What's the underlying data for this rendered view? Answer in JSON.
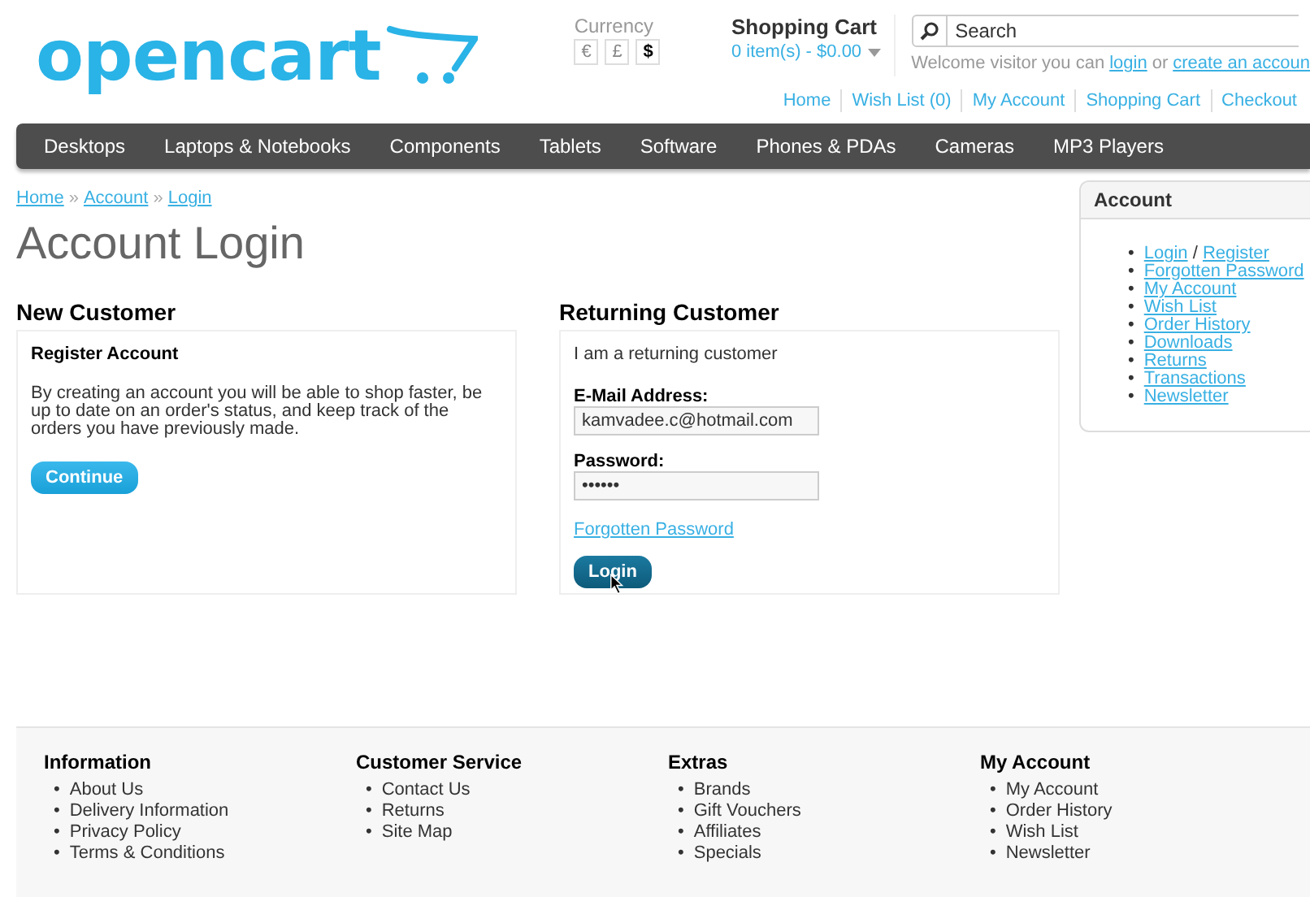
{
  "logo": {
    "text": "opencart"
  },
  "currency": {
    "label": "Currency",
    "options": [
      {
        "symbol": "€",
        "selected": false
      },
      {
        "symbol": "£",
        "selected": false
      },
      {
        "symbol": "$",
        "selected": true
      }
    ]
  },
  "cart": {
    "title": "Shopping Cart",
    "summary": "0 item(s) - $0.00"
  },
  "search": {
    "placeholder": "Search"
  },
  "welcome": {
    "text": "Welcome visitor you can",
    "login": "login",
    "or": "or",
    "create": "create an accoun"
  },
  "top_links": [
    "Home",
    "Wish List (0)",
    "My Account",
    "Shopping Cart",
    "Checkout"
  ],
  "menu": [
    "Desktops",
    "Laptops & Notebooks",
    "Components",
    "Tablets",
    "Software",
    "Phones & PDAs",
    "Cameras",
    "MP3 Players"
  ],
  "breadcrumb": {
    "items": [
      "Home",
      "Account",
      "Login"
    ],
    "separator": "»"
  },
  "page_title": "Account Login",
  "new_customer": {
    "heading": "New Customer",
    "subheading": "Register Account",
    "text": "By creating an account you will be able to shop faster, be up to date on an order's status, and keep track of the orders you have previously made.",
    "button": "Continue"
  },
  "returning_customer": {
    "heading": "Returning Customer",
    "intro": "I am a returning customer",
    "email_label": "E-Mail Address:",
    "email_value": "kamvadee.c@hotmail.com",
    "password_label": "Password:",
    "password_value": "••••••",
    "forgot_link": "Forgotten Password",
    "button": "Login"
  },
  "sidebar": {
    "title": "Account",
    "separator": "/",
    "bullet": "•",
    "items": [
      [
        "Login",
        "Register"
      ],
      [
        "Forgotten Password"
      ],
      [
        "My Account"
      ],
      [
        "Wish List"
      ],
      [
        "Order History"
      ],
      [
        "Downloads"
      ],
      [
        "Returns"
      ],
      [
        "Transactions"
      ],
      [
        "Newsletter"
      ]
    ]
  },
  "footer": {
    "bullet": "•",
    "columns": [
      {
        "title": "Information",
        "links": [
          "About Us",
          "Delivery Information",
          "Privacy Policy",
          "Terms & Conditions"
        ]
      },
      {
        "title": "Customer Service",
        "links": [
          "Contact Us",
          "Returns",
          "Site Map"
        ]
      },
      {
        "title": "Extras",
        "links": [
          "Brands",
          "Gift Vouchers",
          "Affiliates",
          "Specials"
        ]
      },
      {
        "title": "My Account",
        "links": [
          "My Account",
          "Order History",
          "Wish List",
          "Newsletter"
        ]
      }
    ]
  }
}
